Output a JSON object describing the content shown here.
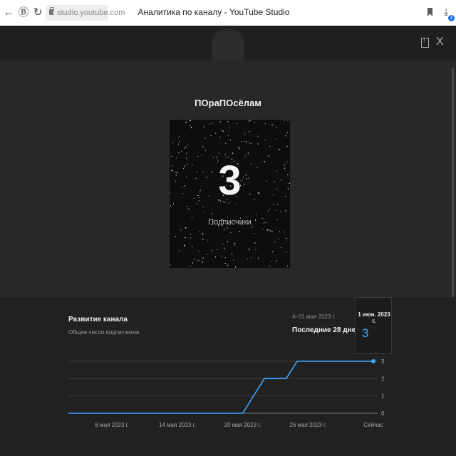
{
  "browser": {
    "url": "studio.youtube.com",
    "title": "Аналитика по каналу - YouTube Studio",
    "download_badge": "1"
  },
  "channel": {
    "name": "ПОраПОсёлам",
    "subscriber_count": "3",
    "subscriber_label": "Подписчики"
  },
  "growth": {
    "title": "Развитие канала",
    "subtitle": "Общее число подписчиков",
    "date_range": "4–31 мая 2023 г.",
    "period_label": "Последние 28 дней",
    "tooltip_date": "1 июн. 2023 г.",
    "tooltip_value": "3"
  },
  "colors": {
    "accent": "#3ea6ff",
    "line": "#3ea6ff"
  },
  "chart_data": {
    "type": "line",
    "xlabel": "",
    "ylabel": "",
    "x_ticks": [
      "8 мая 2023 г.",
      "14 мая 2023 г.",
      "20 мая 2023 г.",
      "26 мая 2023 г.",
      "Сейчас"
    ],
    "y_ticks": [
      0,
      1,
      2,
      3
    ],
    "ylim": [
      0,
      3
    ],
    "grid": true,
    "series": [
      {
        "x": [
          "4 мая 2023 г.",
          "20 мая 2023 г.",
          "22 мая 2023 г.",
          "24 мая 2023 г.",
          "25 мая 2023 г.",
          "1 июн. 2023 г."
        ],
        "values": [
          0,
          0,
          2,
          2,
          3,
          3
        ]
      }
    ]
  }
}
